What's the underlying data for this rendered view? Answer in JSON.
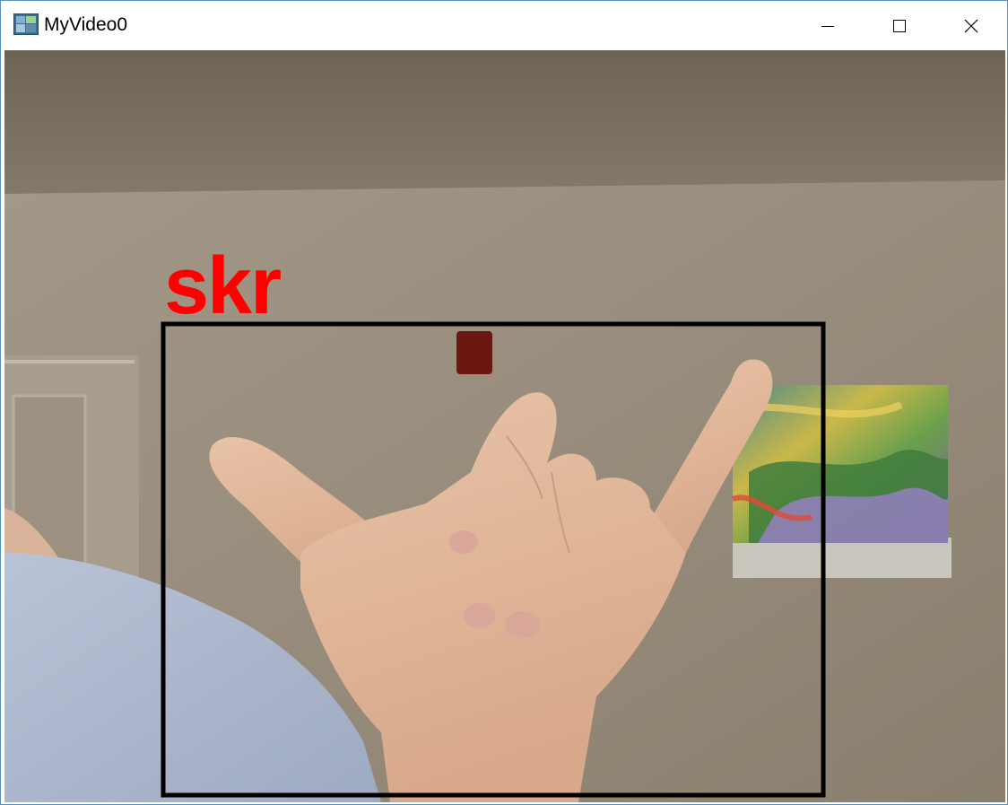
{
  "window": {
    "title": "MyVideo0",
    "controls": {
      "minimize_icon": "minimize-icon",
      "maximize_icon": "maximize-icon",
      "close_icon": "close-icon"
    }
  },
  "video_frame": {
    "detection_label": "skr",
    "label_color": "#ff0000",
    "box_color": "#000000"
  }
}
